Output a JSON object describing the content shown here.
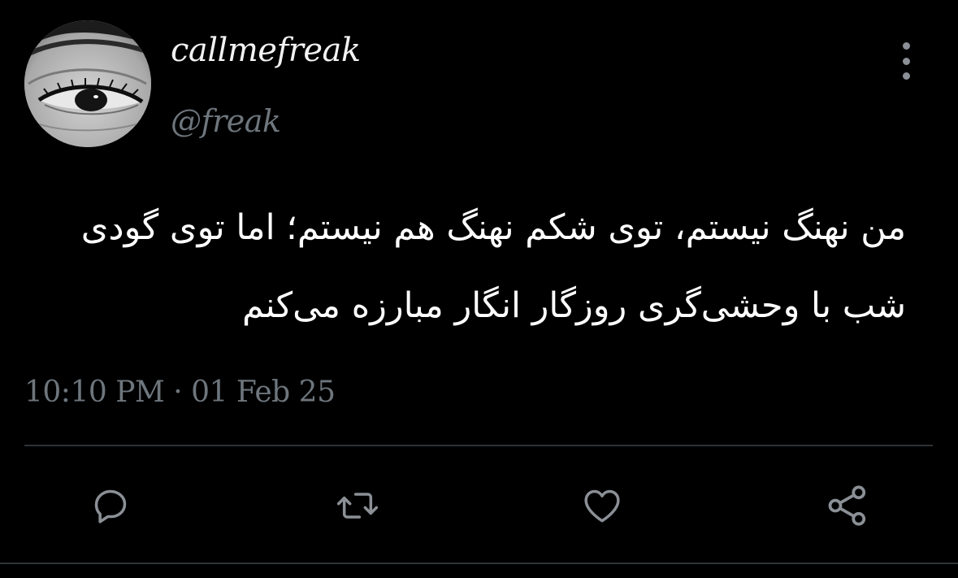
{
  "user": {
    "display_name": "callmefreak",
    "handle": "@freak",
    "avatar_icon": "eye-photo"
  },
  "tweet": {
    "text_lines": [
      "من نهنگ نیستم، توی شکم نهنگ هم نیستم؛ اما توی گودی",
      "شب با وحشی‌گری روزگار انگار مبارزه می‌کنم"
    ],
    "timestamp": "10:10 PM · 01 Feb 25"
  },
  "menu": {
    "icon": "more-vertical-icon"
  },
  "actions": [
    {
      "name": "reply",
      "icon": "reply-icon"
    },
    {
      "name": "retweet",
      "icon": "retweet-icon"
    },
    {
      "name": "like",
      "icon": "heart-icon"
    },
    {
      "name": "share",
      "icon": "share-icon"
    }
  ],
  "colors": {
    "background": "#000000",
    "text": "#ffffff",
    "muted": "#6e767d",
    "icon": "#8b9096",
    "divider": "#2f3336"
  }
}
